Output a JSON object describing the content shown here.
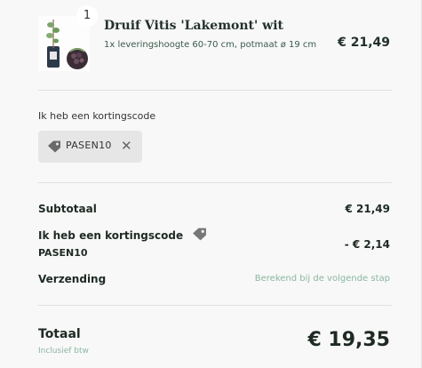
{
  "product": {
    "quantity": "1",
    "name": "Druif Vitis 'Lakemont' wit",
    "description": "1x leveringshoogte 60-70 cm, potmaat ø 19 cm",
    "price": "€ 21,49"
  },
  "discount": {
    "label": "Ik heb een kortingscode",
    "code": "PASEN10"
  },
  "summary": {
    "subtotal_label": "Subtotaal",
    "subtotal_value": "€ 21,49",
    "discount_label": "Ik heb een kortingscode",
    "discount_code": "PASEN10",
    "discount_value": "- € 2,14",
    "shipping_label": "Verzending",
    "shipping_value": "Berekend bij de volgende stap"
  },
  "total": {
    "label": "Totaal",
    "sublabel": "Inclusief btw",
    "value": "€ 19,35"
  },
  "colors": {
    "accent_green": "#8ab7a1",
    "text_dark": "#1e2a23",
    "chip_bg": "#e6e6e6"
  },
  "icons": [
    "tag-icon",
    "close-icon",
    "product-thumbnail"
  ]
}
